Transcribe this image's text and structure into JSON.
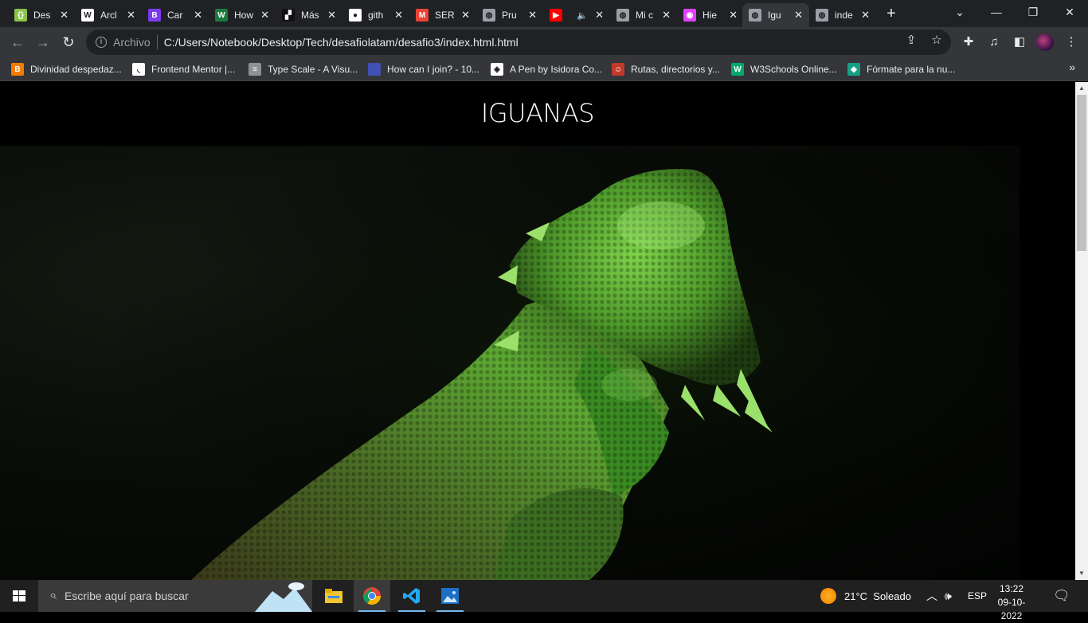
{
  "browser": {
    "tabs": [
      {
        "title": "Des",
        "icon": "replit-icon",
        "color": "#8bc34a",
        "glyph": "{}"
      },
      {
        "title": "Arcl",
        "icon": "wikipedia-icon",
        "color": "#ffffff",
        "glyph": "W"
      },
      {
        "title": "Car",
        "icon": "bootstrap-icon",
        "color": "#7c3aed",
        "glyph": "B"
      },
      {
        "title": "How",
        "icon": "wikihow-icon",
        "color": "#1b7a3e",
        "glyph": "W"
      },
      {
        "title": "Más",
        "icon": "pixel-icon",
        "color": "#111111",
        "glyph": "▞"
      },
      {
        "title": "gith",
        "icon": "github-icon",
        "color": "#ffffff",
        "glyph": "●"
      },
      {
        "title": "SER",
        "icon": "gmail-icon",
        "color": "#ea4335",
        "glyph": "M"
      },
      {
        "title": "Pru",
        "icon": "globe-icon",
        "color": "#9aa0a6",
        "glyph": "◍"
      },
      {
        "title": "",
        "icon": "youtube-icon",
        "color": "#ff0000",
        "glyph": "▶"
      },
      {
        "title": "Mi c",
        "icon": "globe-icon",
        "color": "#9aa0a6",
        "glyph": "◍"
      },
      {
        "title": "Hie",
        "icon": "app-icon",
        "color": "#e040fb",
        "glyph": "◉"
      },
      {
        "title": "Igu",
        "icon": "globe-icon",
        "color": "#9aa0a6",
        "glyph": "◍",
        "active": true
      },
      {
        "title": "inde",
        "icon": "globe-icon",
        "color": "#9aa0a6",
        "glyph": "◍"
      }
    ],
    "address": {
      "chip": "Archivo",
      "url": "C:/Users/Notebook/Desktop/Tech/desafiolatam/desafio3/index.html.html"
    },
    "bookmarks": [
      {
        "label": "Divinidad despedaz...",
        "icon": "blogger-icon",
        "color": "#f57c00",
        "glyph": "B"
      },
      {
        "label": "Frontend Mentor |...",
        "icon": "frontend-mentor-icon",
        "color": "#ffffff",
        "glyph": "◟"
      },
      {
        "label": "Type Scale - A Visu...",
        "icon": "type-scale-icon",
        "color": "#8e9196",
        "glyph": "≡"
      },
      {
        "label": "How can I join? - 10...",
        "icon": "site-icon",
        "color": "#3f51b5",
        "glyph": ""
      },
      {
        "label": "A Pen by Isidora Co...",
        "icon": "codepen-icon",
        "color": "#ffffff",
        "glyph": "◈"
      },
      {
        "label": "Rutas, directorios y...",
        "icon": "avatar-icon",
        "color": "#c0392b",
        "glyph": "☺"
      },
      {
        "label": "W3Schools Online...",
        "icon": "w3schools-icon",
        "color": "#04aa6d",
        "glyph": "W"
      },
      {
        "label": "Fórmate para la nu...",
        "icon": "course-icon",
        "color": "#16a085",
        "glyph": "◆"
      }
    ]
  },
  "page": {
    "heading": "IGUANAS"
  },
  "taskbar": {
    "search_placeholder": "Escribe aquí para buscar",
    "weather": "21°C  Soleado",
    "language": "ESP",
    "time": "13:22",
    "date": "09-10-2022"
  }
}
